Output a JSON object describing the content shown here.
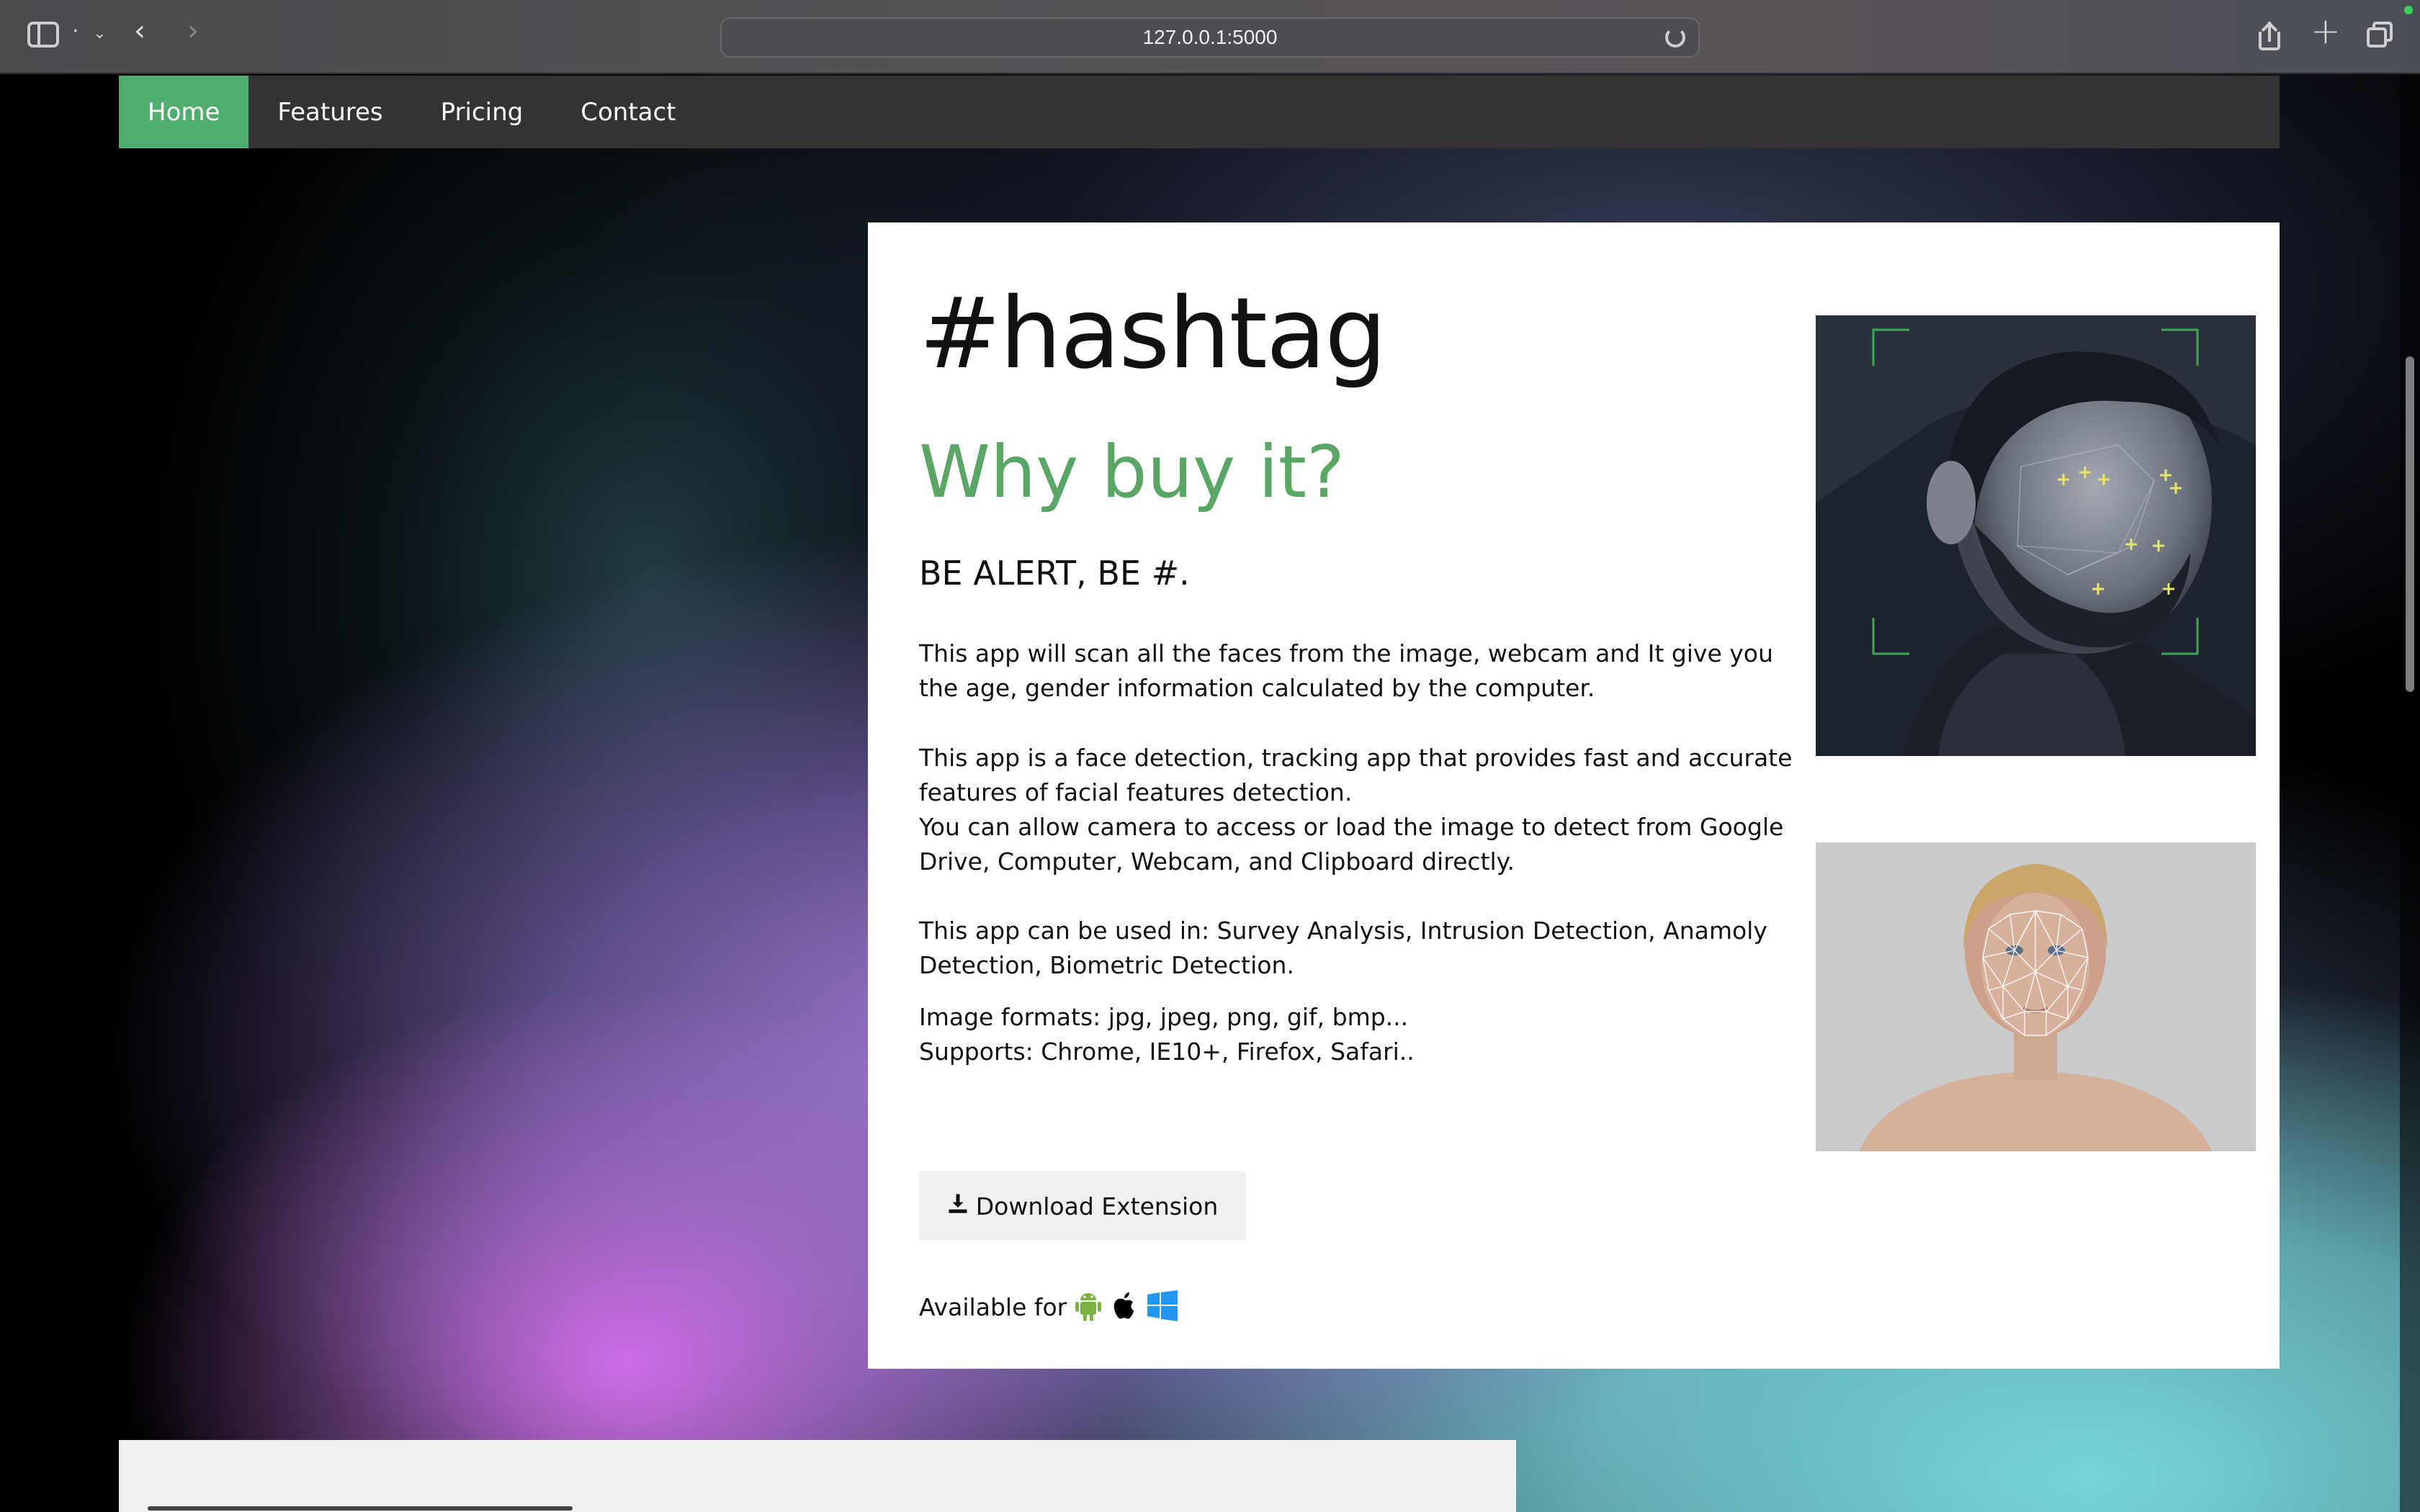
{
  "browser": {
    "tab_dropdown_label": "·",
    "url": "127.0.0.1:5000"
  },
  "nav": {
    "items": [
      {
        "label": "Home",
        "active": true
      },
      {
        "label": "Features",
        "active": false
      },
      {
        "label": "Pricing",
        "active": false
      },
      {
        "label": "Contact",
        "active": false
      }
    ]
  },
  "hero": {
    "title": "#hashtag",
    "subtitle": "Why buy it?",
    "tagline": "BE ALERT, BE #.",
    "paragraphs": [
      "This app will scan all the faces from the image, webcam and It give you the age, gender information calculated by the computer.",
      "This app is a face detection, tracking app that provides fast and accurate features of facial features detection.",
      "You can allow camera to access or load the image to detect from Google Drive, Computer, Webcam, and Clipboard directly.",
      "This app can be used in: Survey Analysis, Intrusion Detection, Anamoly Detection, Biometric Detection.",
      "Image formats: jpg, jpeg, png, gif, bmp...",
      "Supports: Chrome, IE10+, Firefox, Safari.."
    ],
    "download_label": "Download Extension",
    "available_label": "Available for",
    "platforms": [
      "android-icon",
      "apple-icon",
      "windows-icon"
    ]
  },
  "colors": {
    "accent_green": "#4fae6e",
    "subtitle_green": "#5aa765",
    "navbar_bg": "#333333",
    "android_green": "#7cb342",
    "windows_blue": "#2196f3"
  }
}
